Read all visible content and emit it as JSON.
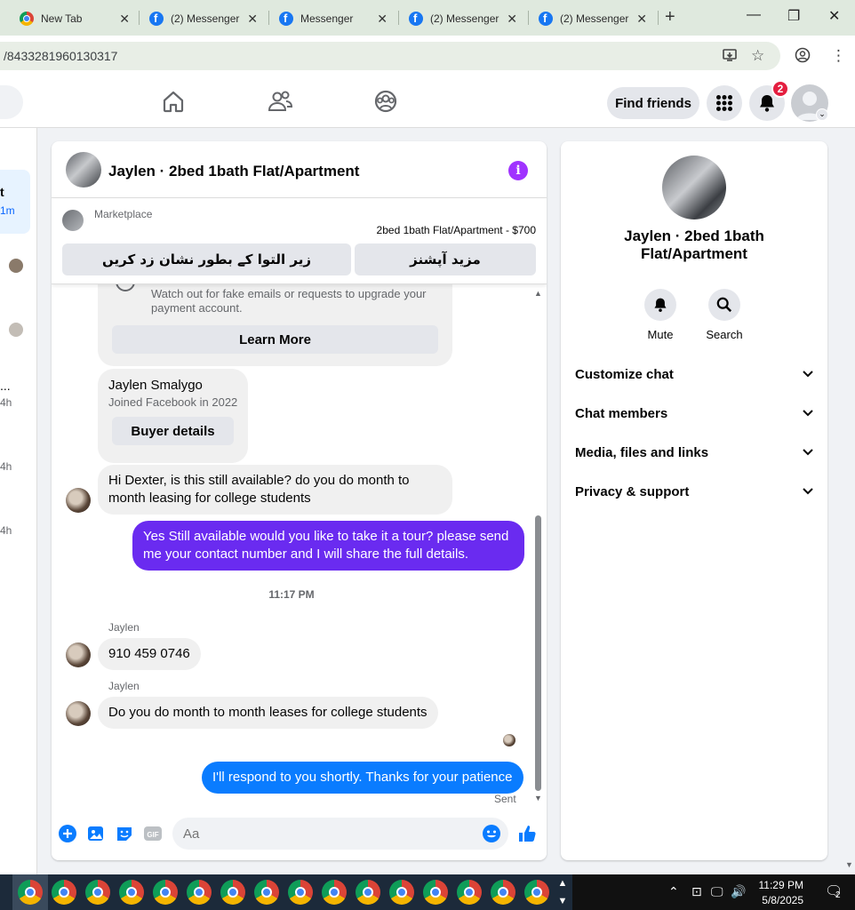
{
  "browser": {
    "tabs": [
      {
        "label": "New Tab",
        "icon": "chrome-icon"
      },
      {
        "label": "(2) Messenger",
        "icon": "facebook-icon"
      },
      {
        "label": "Messenger",
        "icon": "facebook-icon"
      },
      {
        "label": "(2) Messenger",
        "icon": "facebook-icon"
      },
      {
        "label": "(2) Messenger",
        "icon": "facebook-icon"
      }
    ],
    "url": "/8433281960130317"
  },
  "fbnav": {
    "find_friends": "Find friends",
    "notification_count": "2"
  },
  "sidebar": {
    "fragments": [
      "t",
      "1m",
      "...",
      "4h",
      "4h",
      "4h"
    ]
  },
  "chat": {
    "title": "Jaylen · 2bed 1bath Flat/Apartment",
    "marketplace_label": "Marketplace",
    "listing_price": "2bed 1bath Flat/Apartment - $700",
    "mark_pending_button": "زیر التوا کے بطور نشان زد کریں",
    "more_options_button": "مزید آپشنز",
    "warning_text": "Watch out for fake emails or requests to upgrade your payment account.",
    "learn_more": "Learn More",
    "buyer_name": "Jaylen Smalygo",
    "buyer_joined": "Joined Facebook in 2022",
    "buyer_details": "Buyer details",
    "messages": {
      "m1": "Hi Dexter, is this still available? do you do month to month leasing for college students",
      "m2": "Yes Still available would you like to take it a tour? please send me your contact number and I will share the full details.",
      "time": "11:17 PM",
      "sender1": "Jaylen",
      "m3": "910 459 0746",
      "sender2": "Jaylen",
      "m4": "Do you do month to month leases for college students",
      "m5": "I'll respond to you shortly. Thanks for your patience",
      "status": "Sent"
    },
    "input_placeholder": "Aa",
    "colors": {
      "outgoing_purple": "#6a2bf0",
      "outgoing_blue": "#0a7cff",
      "accent": "#a033ff"
    }
  },
  "info": {
    "name": "Jaylen · 2bed 1bath Flat/Apartment",
    "mute": "Mute",
    "search": "Search",
    "sections": [
      "Customize chat",
      "Chat members",
      "Media, files and links",
      "Privacy & support"
    ]
  },
  "taskbar": {
    "time": "11:29 PM",
    "date": "5/8/2025",
    "notification_count": "2"
  }
}
